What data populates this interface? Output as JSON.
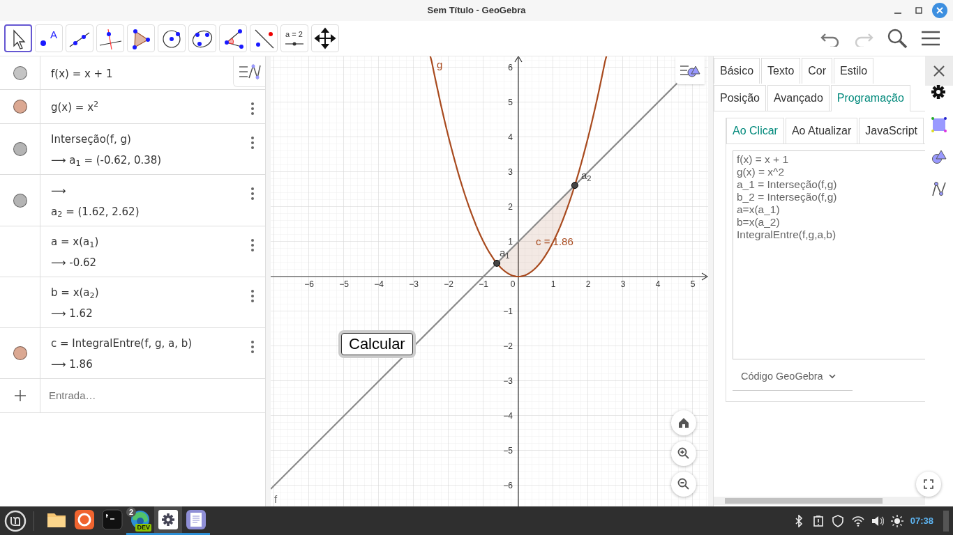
{
  "window": {
    "title": "Sem Título - GeoGebra"
  },
  "toolbar": {
    "tools": [
      {
        "kind": "move",
        "selected": true
      },
      {
        "kind": "point",
        "selected": false,
        "label": "A"
      },
      {
        "kind": "line",
        "selected": false
      },
      {
        "kind": "perpendicular",
        "selected": false
      },
      {
        "kind": "polygon",
        "selected": false
      },
      {
        "kind": "circle",
        "selected": false
      },
      {
        "kind": "conic",
        "selected": false
      },
      {
        "kind": "angle",
        "selected": false
      },
      {
        "kind": "reflect",
        "selected": false
      },
      {
        "kind": "slider",
        "selected": false,
        "label": "a = 2"
      },
      {
        "kind": "translate",
        "selected": false
      }
    ],
    "undo": {
      "disabled": false
    },
    "redo": {
      "disabled": true
    }
  },
  "algebra": {
    "rows": [
      {
        "color": "#c4c4c4",
        "menu": false,
        "lines": [
          "f(x) = x + 1"
        ]
      },
      {
        "color": "#dba892",
        "menu": true,
        "lines": [
          "g(x) = x$^{2}$"
        ]
      },
      {
        "color": "#b4b4b4",
        "menu": true,
        "lines": [
          "Interseção(f, g)",
          "⟶ a$_{1}$ = (-0.62, 0.38)"
        ]
      },
      {
        "color": "#b4b4b4",
        "menu": true,
        "lines": [
          "⟶",
          "a$_{2}$ = (1.62, 2.62)"
        ]
      },
      {
        "menu": true,
        "lines": [
          "a = x(a$_{1}$)",
          "⟶ -0.62"
        ]
      },
      {
        "menu": true,
        "lines": [
          "b = x(a$_{2}$)",
          "⟶ 1.62"
        ]
      },
      {
        "color": "#dba892",
        "menu": true,
        "lines": [
          "c = IntegralEntre(f, g, a, b)",
          "⟶ 1.86"
        ]
      }
    ],
    "input": {
      "placeholder": "Entrada…"
    }
  },
  "graphics": {
    "x_tick_labels": [
      "−6",
      "−5",
      "−4",
      "−3",
      "−2",
      "−1",
      "0",
      "1",
      "2",
      "3",
      "4",
      "5"
    ],
    "y_tick_labels": [
      "6",
      "5",
      "4",
      "3",
      "2",
      "1",
      "−1",
      "−2",
      "−3",
      "−4",
      "−5",
      "−6"
    ],
    "curve_g_label": "g",
    "curve_f_label": "f",
    "area_label": "c = 1.86",
    "point_labels": [
      "a$_{1}$",
      "a$_{2}$"
    ],
    "button": "Calcular"
  },
  "properties": {
    "tab_rows": [
      [
        {
          "label": "Básico",
          "selected": false
        },
        {
          "label": "Texto",
          "selected": false
        },
        {
          "label": "Cor",
          "selected": false
        },
        {
          "label": "Estilo",
          "selected": false
        }
      ],
      [
        {
          "label": "Posição",
          "selected": false
        },
        {
          "label": "Avançado",
          "selected": false
        },
        {
          "label": "Programação",
          "selected": true
        }
      ]
    ],
    "script_tabs": [
      {
        "label": "Ao Clicar",
        "selected": true
      },
      {
        "label": "Ao Atualizar",
        "selected": false
      },
      {
        "label": "JavaScript",
        "selected": false
      }
    ],
    "script": [
      "f(x) = x + 1",
      "g(x) = x^2",
      "a_1 = Interseção(f,g)",
      "b_2 = Interseção(f,g)",
      "a=x(a_1)",
      "b=x(a_2)",
      "IntegralEntre(f,g,a,b)"
    ],
    "language": "Código GeoGebra"
  },
  "taskbar": {
    "apps": [
      {
        "kind": "files",
        "running": false,
        "focused": false
      },
      {
        "kind": "firefox",
        "running": false,
        "focused": false
      },
      {
        "kind": "terminal",
        "running": false,
        "focused": false
      },
      {
        "kind": "edge",
        "running": true,
        "focused": false,
        "badge": "2",
        "tag": "DEV"
      },
      {
        "kind": "settings",
        "running": true,
        "focused": true
      },
      {
        "kind": "notes",
        "running": true,
        "focused": false
      }
    ],
    "clock": "07:38"
  }
}
